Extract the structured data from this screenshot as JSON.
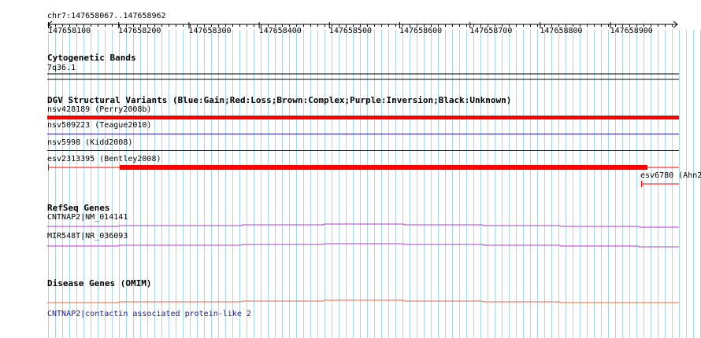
{
  "ruler": {
    "region": "chr7:147658067..147658962",
    "ticks": [
      "147658100",
      "147658200",
      "147658300",
      "147658400",
      "147658500",
      "147658600",
      "147658700",
      "147658800",
      "147658900"
    ]
  },
  "tracks": {
    "cytoband": {
      "title": "Cytogenetic Bands",
      "band": "7q36.1"
    },
    "dgv": {
      "title": "DGV Structural Variants (Blue:Gain;Red:Loss;Brown:Complex;Purple:Inversion;Black:Unknown)",
      "features": [
        {
          "label": "nsv428189 (Perry2008b)",
          "type": "loss"
        },
        {
          "label": "nsv509223 (Teague2010)",
          "type": "gain"
        },
        {
          "label": "nsv5998 (Kidd2008)",
          "type": "gain"
        },
        {
          "label": "esv2313395 (Bentley2008)",
          "type": "loss"
        },
        {
          "label": "esv6780 (Ahn2",
          "type": "loss"
        }
      ]
    },
    "refseq": {
      "title": "RefSeq Genes",
      "genes": [
        {
          "label": "CNTNAP2|NM_014141"
        },
        {
          "label": "MIR548T|NR_036093"
        }
      ]
    },
    "omim": {
      "title": "Disease Genes (OMIM)",
      "genes": [
        {
          "label": "CNTNAP2|contactin associated protein-like 2"
        }
      ]
    }
  },
  "colors": {
    "grid": "#a8d8e8",
    "loss": "#ff0000",
    "gain": "#1a1aa0",
    "gene": "#b040c8",
    "omim": "#e06848",
    "omim_label": "#1a1aa0"
  }
}
